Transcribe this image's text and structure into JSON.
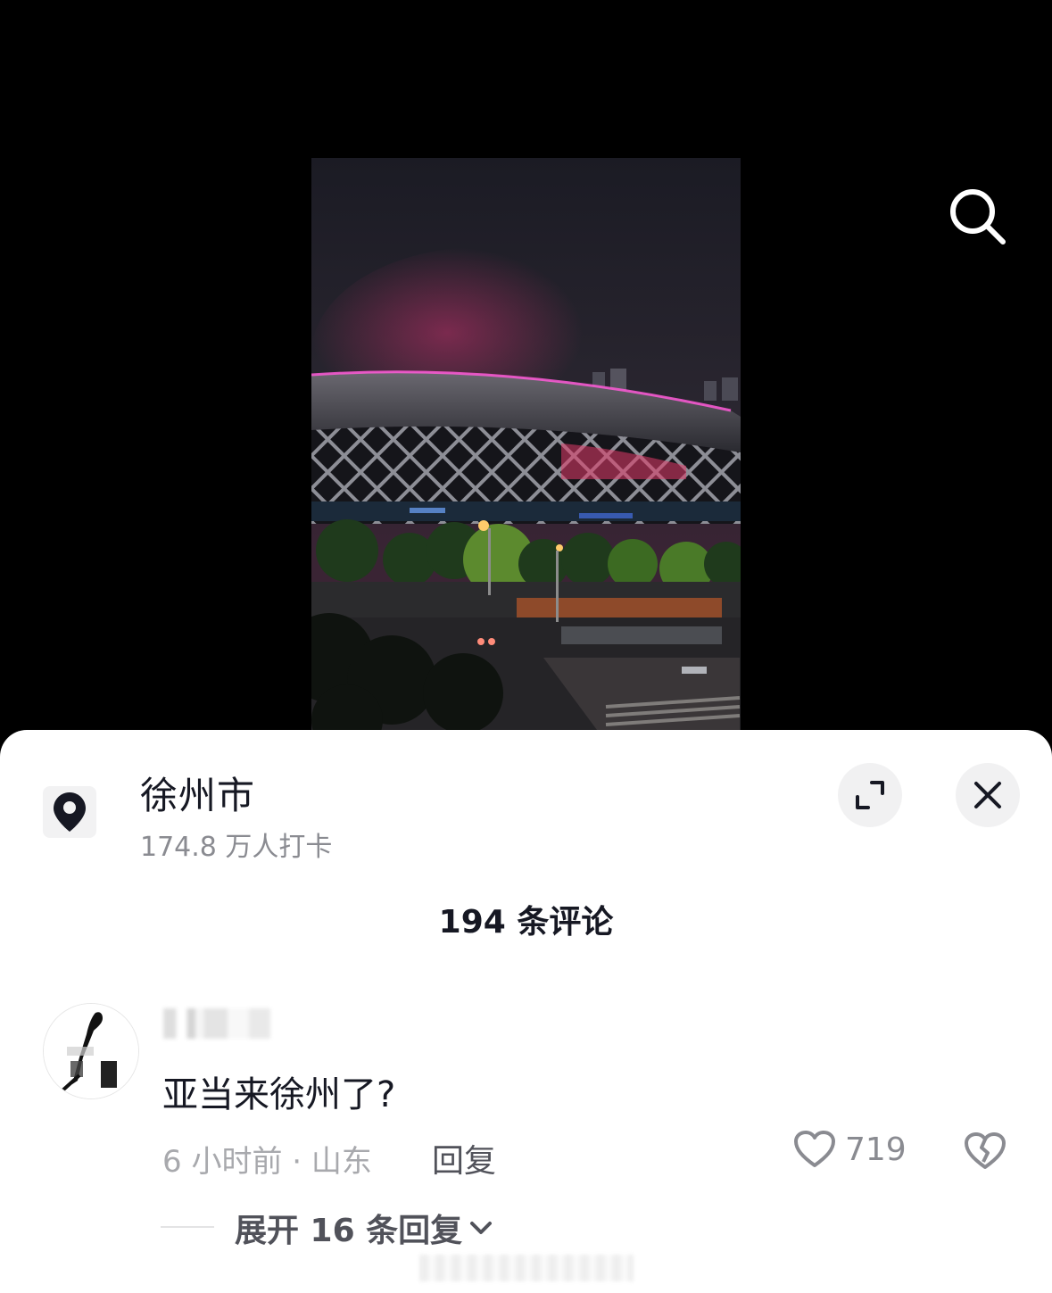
{
  "location": {
    "title": "徐州市",
    "subtitle": "174.8 万人打卡"
  },
  "comments": {
    "count_label": "194 条评论",
    "items": [
      {
        "text": "亚当来徐州了?",
        "meta": "6 小时前 · 山东",
        "reply_label": "回复",
        "likes": "719",
        "expand_label": "展开 16 条回复"
      }
    ]
  },
  "icons": {
    "search": "search-icon",
    "location": "location-pin-icon",
    "expand": "expand-icon",
    "close": "close-icon",
    "like": "heart-icon",
    "dislike": "broken-heart-icon",
    "chevron": "chevron-down-icon"
  },
  "colors": {
    "text_primary": "#161823",
    "text_secondary": "#8a8b91",
    "sheet_bg": "#ffffff",
    "button_bg": "#f1f1f2"
  }
}
